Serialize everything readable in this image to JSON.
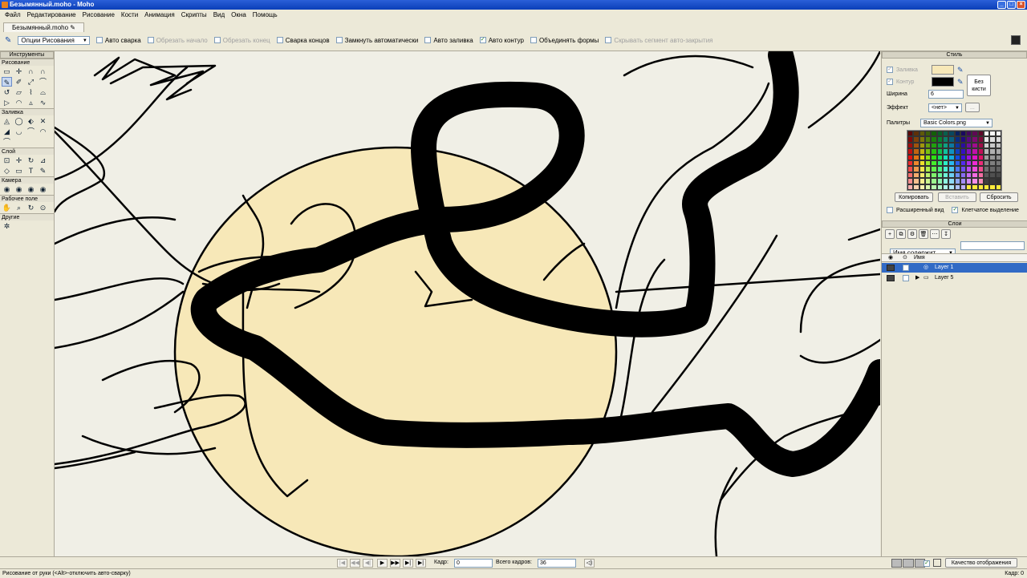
{
  "window": {
    "title": "Безымянный.moho - Moho"
  },
  "menu": [
    "Файл",
    "Редактирование",
    "Рисование",
    "Кости",
    "Анимация",
    "Скрипты",
    "Вид",
    "Окна",
    "Помощь"
  ],
  "document_tab": "Безымянный.moho",
  "options": {
    "dropdown": "Опции Рисования",
    "items": [
      {
        "label": "Авто сварка",
        "checked": false,
        "disabled": false
      },
      {
        "label": "Обрезать начало",
        "checked": false,
        "disabled": true
      },
      {
        "label": "Обрезать конец",
        "checked": false,
        "disabled": true
      },
      {
        "label": "Сварка концов",
        "checked": false,
        "disabled": false
      },
      {
        "label": "Замкнуть автоматически",
        "checked": false,
        "disabled": false
      },
      {
        "label": "Авто заливка",
        "checked": false,
        "disabled": false
      },
      {
        "label": "Авто контур",
        "checked": true,
        "disabled": false
      },
      {
        "label": "Объединять формы",
        "checked": false,
        "disabled": false
      },
      {
        "label": "Скрывать сегмент авто-закрытия",
        "checked": false,
        "disabled": true
      }
    ]
  },
  "tools": {
    "header": "Инструменты",
    "groups": [
      {
        "label": "Рисование",
        "icons": [
          "▭",
          "✛",
          "∩",
          "∩",
          "✎",
          "✐",
          "⤢",
          "⌒",
          "↺",
          "▱",
          "⌇",
          "⌓",
          "▷",
          "◠",
          "▵",
          "∿"
        ]
      },
      {
        "label": "Заливка",
        "icons": [
          "◬",
          "◯",
          "⬖",
          "✕",
          "◢",
          "◡",
          "⌒",
          "◠",
          "⌒"
        ]
      },
      {
        "label": "Слой",
        "icons": [
          "⊡",
          "✛",
          "↻",
          "⊿",
          "◇",
          "▭",
          "T",
          "✎"
        ]
      },
      {
        "label": "Камера",
        "icons": [
          "◉",
          "◉",
          "◉",
          "◉"
        ]
      },
      {
        "label": "Рабочее поле",
        "icons": [
          "✋",
          "⌕",
          "↻",
          "⊙"
        ]
      },
      {
        "label": "Другие",
        "icons": [
          "✲"
        ]
      }
    ]
  },
  "style": {
    "header": "Стиль",
    "fill_label": "Заливка",
    "stroke_label": "Контур",
    "fill_color": "#f7e8b8",
    "stroke_color": "#000000",
    "width_label": "Ширина",
    "width_value": "6",
    "no_brush": "Без кисти",
    "effect_label": "Эффект",
    "effect_value": "<нет>",
    "effect_more": "...",
    "palette_label": "Палитры",
    "palette_value": "Basic Colors.png",
    "copy": "Копировать",
    "paste": "Вставить",
    "reset": "Сбросить",
    "expanded_view": "Расширенный вид",
    "checker_select": "Клетчатое выделение"
  },
  "layers": {
    "header": "Слои",
    "filter": "Имя содержит...",
    "name_col": "Имя",
    "items": [
      {
        "name": "Layer 1",
        "selected": true
      },
      {
        "name": "Layer 5",
        "selected": false
      }
    ]
  },
  "timeline": {
    "frame_label": "Кадр:",
    "frame_value": "0",
    "total_label": "Всего кадров:",
    "total_value": "36",
    "quality": "Качество отображения"
  },
  "status": {
    "text": "Рисование от руки (<Alt>-отключить авто-сварку)",
    "right": "Кадр: 0"
  }
}
